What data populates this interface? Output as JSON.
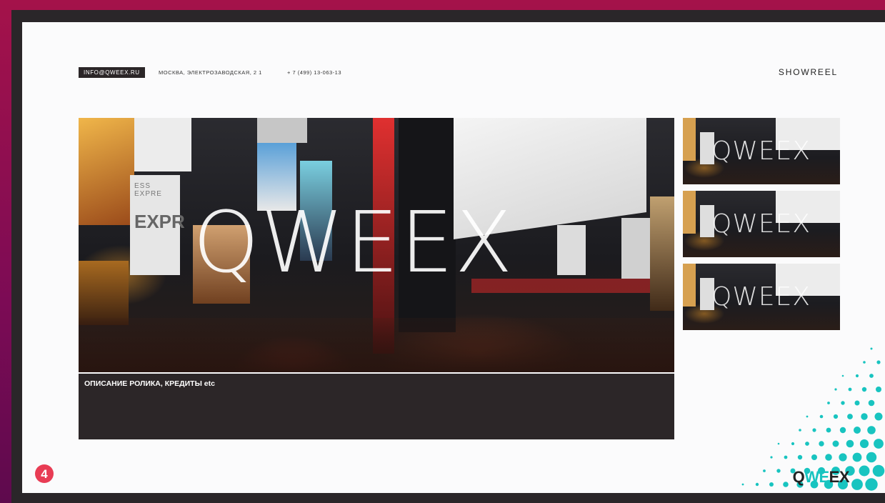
{
  "header": {
    "email": "INFO@QWEEX.RU",
    "address": "МОСКВА, ЭЛЕКТРОЗАВОДСКАЯ, 2 1",
    "phone": "+ 7 (499) 13-063-13",
    "nav_label": "SHOWREEL"
  },
  "hero": {
    "logo_text": "QWEEX",
    "billboard_text": "EXPR",
    "billboard_small": "ESS EXPRE"
  },
  "description": {
    "title": "ОПИСАНИЕ РОЛИКА, КРЕДИТЫ etc"
  },
  "thumbnails": [
    {
      "logo_text": "QWEEX"
    },
    {
      "logo_text": "QWEEX"
    },
    {
      "logo_text": "QWEEX"
    }
  ],
  "footer": {
    "brand_q": "Q",
    "brand_we": "WE",
    "brand_ex": "EX",
    "corner_badge": "4"
  },
  "colors": {
    "accent": "#18c4c0",
    "dark": "#2b2628",
    "corner_badge": "#e83c54",
    "background": "#a4124a"
  }
}
